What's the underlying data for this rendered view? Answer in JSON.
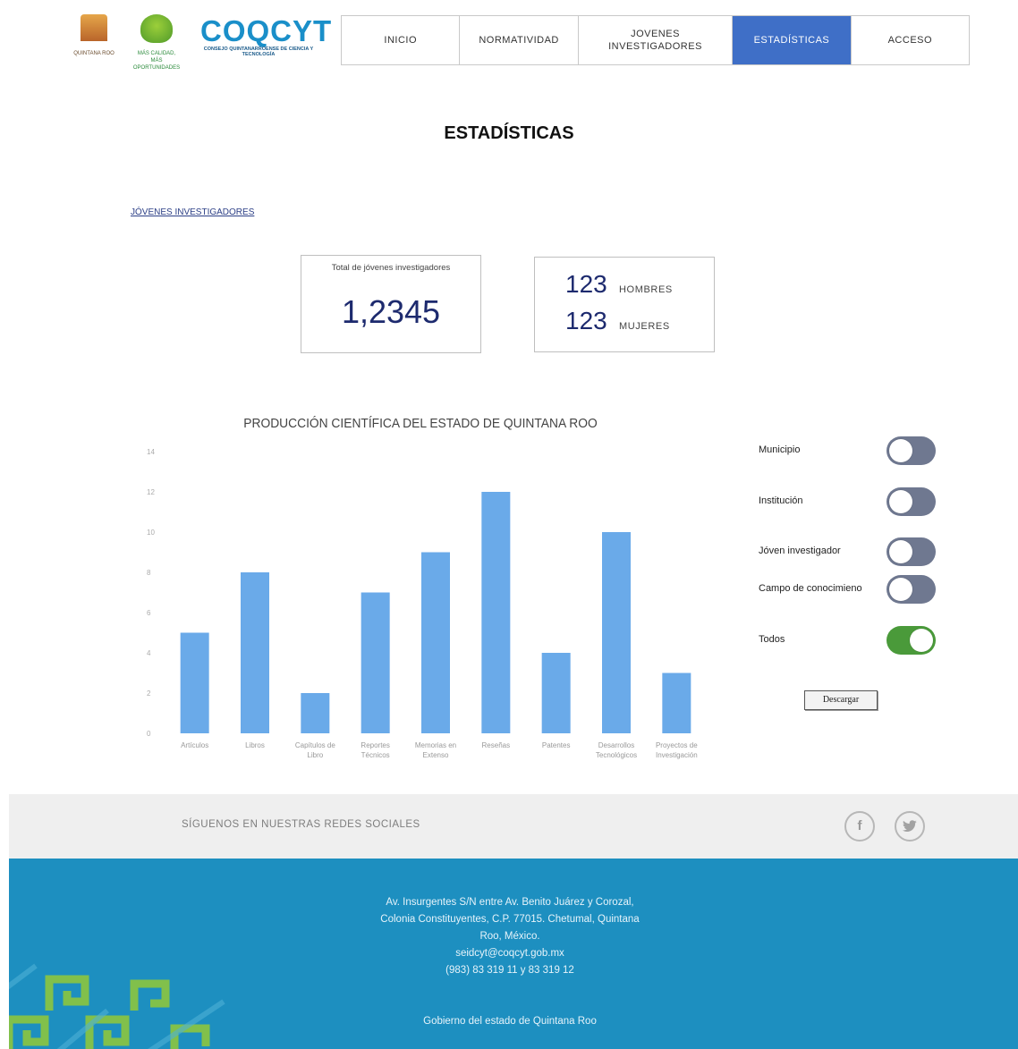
{
  "header": {
    "logo_qroo": "QUINTANA ROO",
    "logo_tree": "MÁS CALIDAD, MÁS OPORTUNIDADES",
    "logo_coqcyt": "COQCYT",
    "logo_coqcyt_sub": "CONSEJO QUINTANARROENSE DE CIENCIA Y TECNOLOGÍA"
  },
  "nav": [
    {
      "label": "INICIO",
      "active": false
    },
    {
      "label": "NORMATIVIDAD",
      "active": false
    },
    {
      "label": "JOVENES INVESTIGADORES",
      "active": false
    },
    {
      "label": "ESTADÍSTICAS",
      "active": true
    },
    {
      "label": "ACCESO",
      "active": false
    }
  ],
  "page": {
    "title": "ESTADÍSTICAS",
    "section_link": "JÓVENES INVESTIGADORES"
  },
  "stats": {
    "total_label": "Total de jóvenes investigadores",
    "total_value": "1,2345",
    "men_value": "123",
    "men_label": "HOMBRES",
    "women_value": "123",
    "women_label": "MUJERES"
  },
  "chart_title": "PRODUCCIÓN CIENTÍFICA DEL ESTADO DE QUINTANA ROO",
  "chart_data": {
    "type": "bar",
    "title": "PRODUCCIÓN CIENTÍFICA DEL ESTADO DE QUINTANA ROO",
    "categories": [
      [
        "Artículos"
      ],
      [
        "Libros"
      ],
      [
        "Capítulos de",
        "Libro"
      ],
      [
        "Reportes",
        "Técnicos"
      ],
      [
        "Memorias en",
        "Extenso"
      ],
      [
        "Reseñas"
      ],
      [
        "Patentes"
      ],
      [
        "Desarrollos",
        "Tecnológicos"
      ],
      [
        "Proyectos de",
        "Investigación"
      ]
    ],
    "values": [
      5,
      8,
      2,
      7,
      9,
      12,
      4,
      10,
      3
    ],
    "yticks": [
      0,
      2,
      4,
      6,
      8,
      10,
      12,
      14
    ],
    "ylim": [
      0,
      14
    ],
    "bar_color": "#6aaae9",
    "grid": false
  },
  "filters": [
    {
      "label": "Municipio",
      "on": false
    },
    {
      "label": "Institución",
      "on": false
    },
    {
      "label": "Jóven investigador",
      "on": false
    },
    {
      "label": "Campo de conocimieno",
      "on": false
    },
    {
      "label": "Todos",
      "on": true
    }
  ],
  "download_label": "Descargar",
  "social": {
    "text": "SÍGUENOS EN NUESTRAS REDES SOCIALES",
    "facebook_icon": "f",
    "twitter_icon": "✦"
  },
  "footer": {
    "address_lines": [
      "Av. Insurgentes S/N entre Av. Benito Juárez y Corozal,",
      "Colonia Constituyentes, C.P. 77015. Chetumal, Quintana",
      "Roo, México.",
      "seidcyt@coqcyt.gob.mx",
      "(983) 83 319 11 y 83  319  12"
    ],
    "gov": "Gobierno del estado de Quintana Roo",
    "bg_color": "#1d8fc0"
  }
}
